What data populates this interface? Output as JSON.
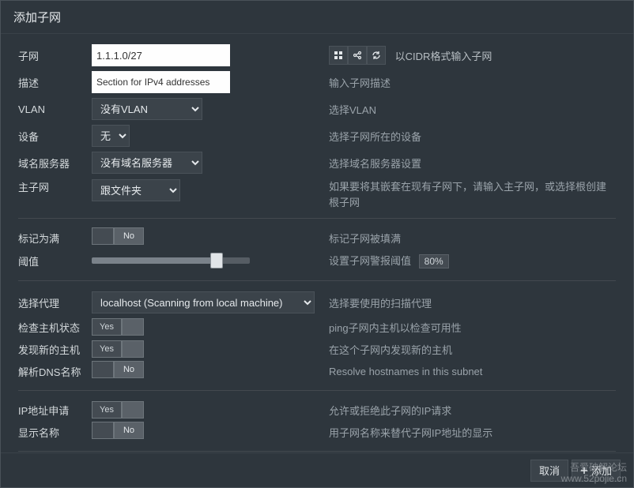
{
  "title": "添加子网",
  "subnet": {
    "label": "子网",
    "value": "1.1.1.0/27",
    "hint": "以CIDR格式输入子网"
  },
  "desc": {
    "label": "描述",
    "value": "Section for IPv4 addresses",
    "hint": "输入子网描述"
  },
  "vlan": {
    "label": "VLAN",
    "value": "没有VLAN",
    "hint": "选择VLAN"
  },
  "device": {
    "label": "设备",
    "value": "无",
    "hint": "选择子网所在的设备"
  },
  "ns": {
    "label": "域名服务器",
    "value": "没有域名服务器",
    "hint": "选择域名服务器设置"
  },
  "master": {
    "label": "主子网",
    "value": "跟文件夹",
    "hint": "如果要将其嵌套在现有子网下，请输入主子网，或选择根创建根子网"
  },
  "markfull": {
    "label": "标记为满",
    "value": "No",
    "hint": "标记子网被填满"
  },
  "threshold": {
    "label": "阈值",
    "percent": 80,
    "hint": "设置子网警报阈值",
    "badge": "80%"
  },
  "agent": {
    "label": "选择代理",
    "value": "localhost (Scanning from local machine)",
    "hint": "选择要使用的扫描代理"
  },
  "ping": {
    "label": "检查主机状态",
    "value": "Yes",
    "hint": "ping子网内主机以检查可用性"
  },
  "discover": {
    "label": "发现新的主机",
    "value": "Yes",
    "hint": "在这个子网内发现新的主机"
  },
  "resolve": {
    "label": "解析DNS名称",
    "value": "No",
    "hint": "Resolve hostnames in this subnet"
  },
  "iprequest": {
    "label": "IP地址申请",
    "value": "Yes",
    "hint": "允许或拒绝此子网的IP请求"
  },
  "showname": {
    "label": "显示名称",
    "value": "No",
    "hint": "用子网名称来替代子网IP地址的显示"
  },
  "footer": {
    "cancel": "取消",
    "add": "添加"
  },
  "watermark": {
    "line1": "吾爱破解论坛",
    "line2": "www.52pojie.cn"
  }
}
